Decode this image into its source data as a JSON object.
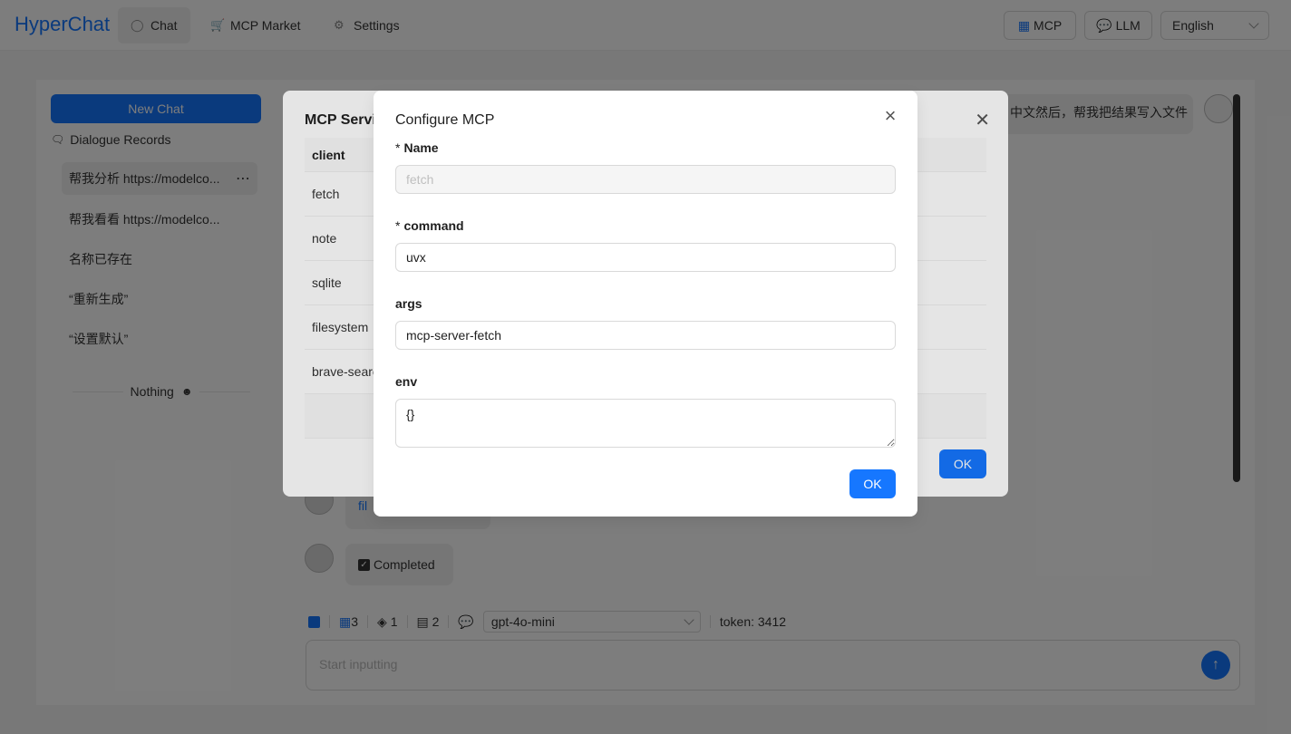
{
  "header": {
    "brand": "HyperChat",
    "nav": [
      {
        "label": "Chat",
        "icon": "chat-bubble-icon"
      },
      {
        "label": "MCP Market",
        "icon": "cart-icon"
      },
      {
        "label": "Settings",
        "icon": "gear-icon"
      }
    ],
    "mcp_button": "MCP",
    "llm_button": "LLM",
    "language": "English"
  },
  "sidebar": {
    "new_chat": "New Chat",
    "records_title": "Dialogue Records",
    "items": [
      {
        "label": "帮我分析 https://modelco..."
      },
      {
        "label": "帮我看看 https://modelco..."
      },
      {
        "label": "名称已存在"
      },
      {
        "label": "“重新生成”"
      },
      {
        "label": "“设置默认”"
      }
    ],
    "more": "⋯",
    "nothing": "Nothing"
  },
  "chat": {
    "user_msg_fragment": "中文然后，帮我把结果写入文件",
    "tool_fragment": "fil",
    "completed": "Completed",
    "toolbar": {
      "mcp_count": "3",
      "tools_count": "1",
      "docs_count": "2",
      "model": "gpt-4o-mini",
      "token": "token: 3412"
    },
    "input_placeholder": "Start inputting"
  },
  "mcp_services_modal": {
    "title": "MCP Servic",
    "column": "client",
    "rows": [
      "fetch",
      "note",
      "sqlite",
      "filesystem",
      "brave-searc"
    ],
    "ok": "OK"
  },
  "configure_modal": {
    "title": "Configure MCP",
    "required_mark": "*",
    "name_label": "Name",
    "name_value": "fetch",
    "command_label": "command",
    "command_value": "uvx",
    "args_label": "args",
    "args_value": "mcp-server-fetch",
    "env_label": "env",
    "env_value": "{}",
    "ok": "OK"
  },
  "colors": {
    "primary": "#1677ff",
    "mask": "rgba(0,0,0,0.45)"
  }
}
